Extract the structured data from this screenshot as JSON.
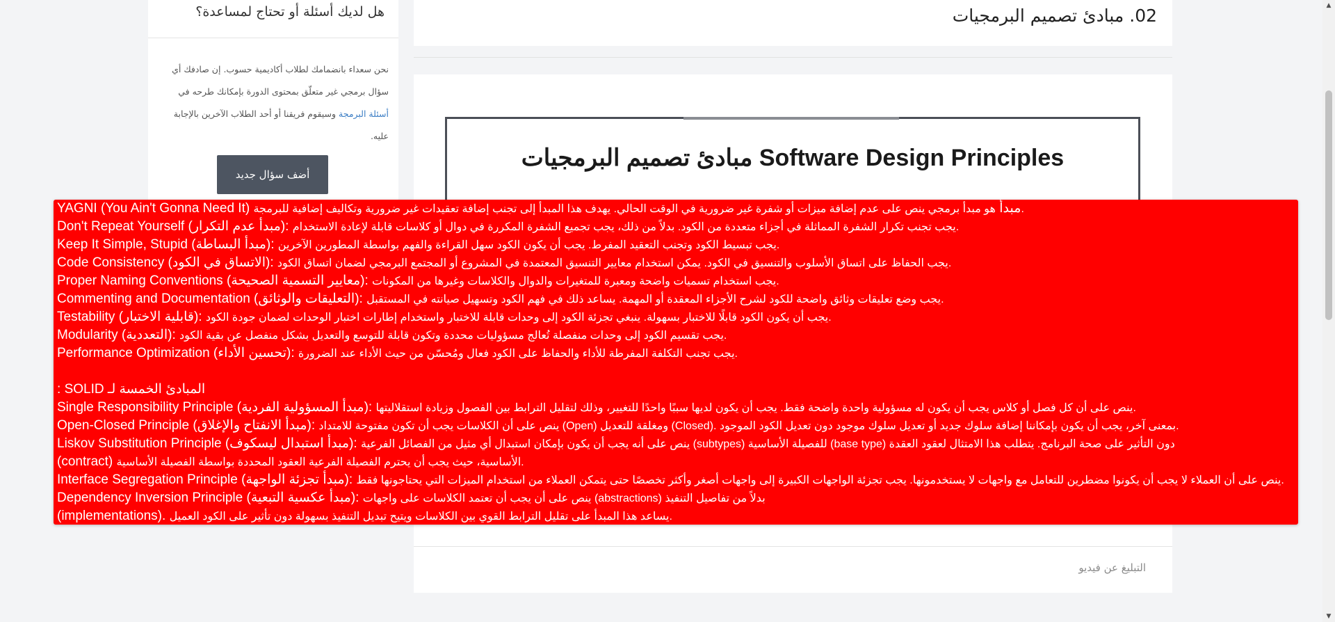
{
  "sidebar": {
    "title": "هل لديك أسئلة أو تحتاج لمساعدة؟",
    "text_before_link": "نحن سعداء بانضمامك لطلاب أكاديمية حسوب. إن صادفك أي سؤال برمجي غير متعلّق بمحتوى الدورة بإمكانك طرحه في ",
    "link_text": "أسئلة البرمجة",
    "text_after_link": " وسيقوم فريقنا أو أحد الطلاب الآخرين بالإجابة عليه.",
    "button_label": "أضف سؤال جديد"
  },
  "lesson": {
    "title": "02. مبادئ تصميم البرمجيات",
    "slide_title": "مبادئ تصميم البرمجيات Software Design Principles",
    "report_link": "التبليغ عن فيديو"
  },
  "overlay": {
    "background": "#ff0000",
    "lines": [
      {
        "term": "YAGNI (You Ain't Gonna Need It) مبدأ",
        "desc": "هو مبدأ برمجي ينص على عدم إضافة ميزات أو شفرة غير ضرورية في الوقت الحالي. يهدف هذا المبدأ إلى تجنب إضافة تعقيدات غير ضرورية وتكاليف إضافية للبرمجة."
      },
      {
        "term": "Don't Repeat Yourself (مبدأ عدم التكرار):",
        "desc": "يجب تجنب تكرار الشفرة المماثلة في أجزاء متعددة من الكود. بدلاً من ذلك، يجب تجميع الشفرة المكررة في دوال أو كلاسات قابلة لإعادة الاستخدام."
      },
      {
        "term": "Keep It Simple, Stupid (مبدأ البساطة):",
        "desc": "يجب تبسيط الكود وتجنب التعقيد المفرط. يجب أن يكون الكود سهل القراءة والفهم بواسطة المطورين الآخرين."
      },
      {
        "term": "Code Consistency (الاتساق في الكود):",
        "desc": "يجب الحفاظ على اتساق الأسلوب والتنسيق في الكود. يمكن استخدام معايير التنسيق المعتمدة في المشروع أو المجتمع البرمجي لضمان اتساق الكود."
      },
      {
        "term": "Proper Naming Conventions (معايير التسمية الصحيحة):",
        "desc": "يجب استخدام تسميات واضحة ومعبرة للمتغيرات والدوال والكلاسات وغيرها من المكونات."
      },
      {
        "term": "Commenting and Documentation (التعليقات والوثائق):",
        "desc": "يجب وضع تعليقات وثائق واضحة للكود لشرح الأجزاء المعقدة أو المهمة. يساعد ذلك في فهم الكود وتسهيل صيانته في المستقبل."
      },
      {
        "term": "Testability (قابلية الاختبار):",
        "desc": "يجب أن يكون الكود قابلًا للاختبار بسهولة. ينبغي تجزئة الكود إلى وحدات قابلة للاختبار واستخدام إطارات اختبار الوحدات لضمان جودة الكود."
      },
      {
        "term": "Modularity (التعددية):",
        "desc": "يجب تقسيم الكود إلى وحدات منفصلة تُعالج مسؤوليات محددة وتكون قابلة للتوسع والتعديل بشكل منفصل عن بقية الكود."
      },
      {
        "term": "Performance Optimization (تحسين الأداء):",
        "desc": "يجب تجنب التكلفة المفرطة للأداء والحفاظ على الكود فعال ومُحسّن من حيث الأداء عند الضرورة."
      },
      {
        "spacer": true
      },
      {
        "term": "المبادئ الخمسة لـ SOLID :",
        "desc": ""
      },
      {
        "term": "Single Responsibility Principle (مبدأ المسؤولية الفردية):",
        "desc": "ينص على أن كل فصل أو كلاس يجب أن يكون له مسؤولية واحدة واضحة فقط. يجب أن يكون لديها سببًا واحدًا للتغيير، وذلك لتقليل الترابط بين الفصول وزيادة استقلاليتها."
      },
      {
        "term": "Open-Closed Principle (مبدأ الانفتاح والإغلاق):",
        "desc": "ينص على أن الكلاسات يجب أن تكون مفتوحة للامتداد (Open) ومغلقة للتعديل (Closed). بمعنى آخر، يجب أن يكون بإمكاننا إضافة سلوك جديد أو تعديل سلوك موجود دون تعديل الكود الموجود."
      },
      {
        "term": "Liskov Substitution Principle (مبدأ استبدال ليسكوف):",
        "desc": "ينص على أنه يجب أن يكون بإمكان استبدال أي مثيل من الفصائل الفرعية (subtypes) للفصيلة الأساسية (base type) دون التأثير على صحة البرنامج. يتطلب هذا الامتثال لعقود العقدة"
      },
      {
        "term": "(contract)",
        "desc": "الأساسية، حيث يجب أن يحترم الفصيلة الفرعية العقود المحددة بواسطة الفصيلة الأساسية."
      },
      {
        "term": "Interface Segregation Principle (مبدأ تجزئة الواجهة):",
        "desc": "ينص على أن العملاء لا يجب أن يكونوا مضطرين للتعامل مع واجهات لا يستخدمونها. يجب تجزئة الواجهات الكبيرة إلى واجهات أصغر وأكثر تخصصًا حتى يتمكن العملاء من استخدام الميزات التي يحتاجونها فقط."
      },
      {
        "term": "Dependency Inversion Principle (مبدأ عكسية التبعية):",
        "desc": "ينص على أن يجب أن تعتمد الكلاسات على واجهات (abstractions) بدلاً من تفاصيل التنفيذ"
      },
      {
        "term": "(implementations).",
        "desc": "يساعد هذا المبدأ على تقليل الترابط القوي بين الكلاسات ويتيح تبديل التنفيذ بسهولة دون تأثير على الكود العميل."
      }
    ]
  },
  "scrollbar": {
    "up_icon": "▲",
    "down_icon": "▼"
  }
}
